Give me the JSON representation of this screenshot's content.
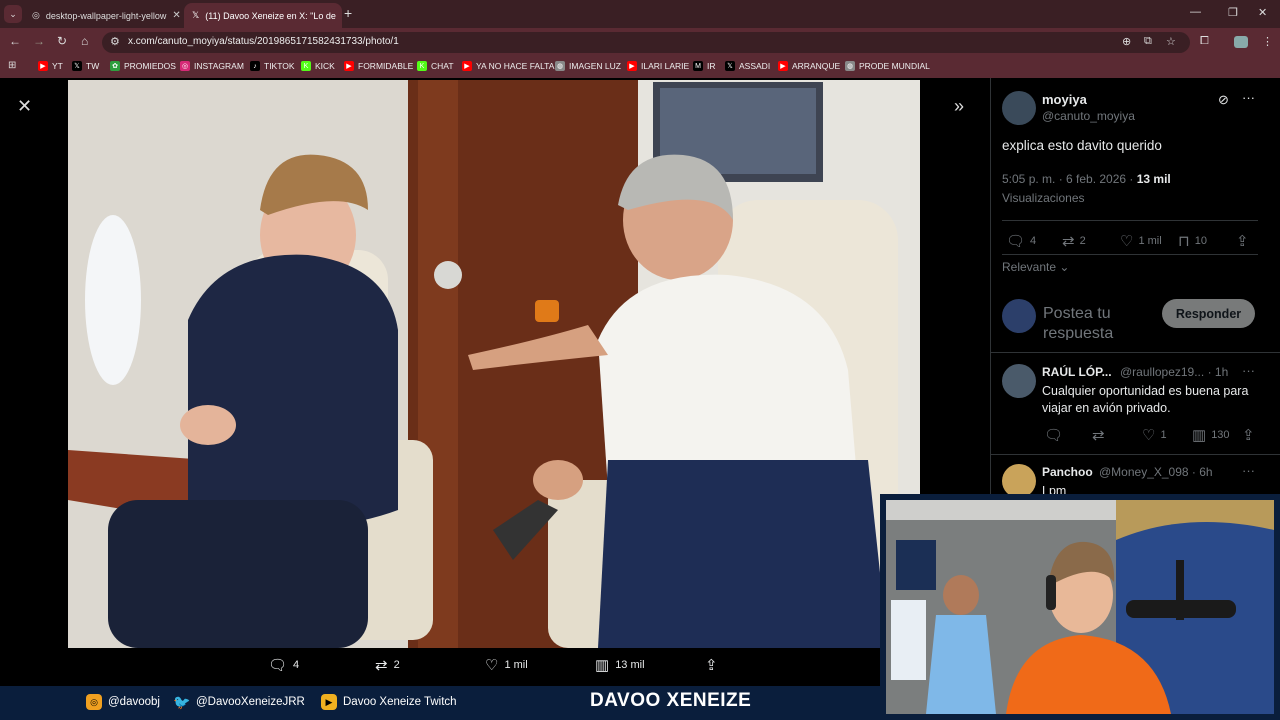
{
  "browser": {
    "tabs": [
      {
        "title": "desktop-wallpaper-light-yellow"
      },
      {
        "title": "(11) Davoo Xeneize en X: \"Lo de"
      }
    ],
    "url": "x.com/canuto_moyiya/status/2019865171582431733/photo/1",
    "bookmarks": [
      {
        "label": "YT",
        "icon": "youtube-icon",
        "color": "#ff0000"
      },
      {
        "label": "TW",
        "icon": "x-icon",
        "color": "#000000"
      },
      {
        "label": "PROMIEDOS",
        "icon": "promiedos-icon",
        "color": "#2e9e3e"
      },
      {
        "label": "INSTAGRAM",
        "icon": "instagram-icon",
        "color": "#d62976"
      },
      {
        "label": "TIKTOK",
        "icon": "tiktok-icon",
        "color": "#000000"
      },
      {
        "label": "KICK",
        "icon": "kick-icon",
        "color": "#53fc18"
      },
      {
        "label": "FORMIDABLE",
        "icon": "youtube-icon",
        "color": "#ff0000"
      },
      {
        "label": "CHAT",
        "icon": "kick-icon",
        "color": "#53fc18"
      },
      {
        "label": "YA NO HACE FALTA",
        "icon": "youtube-icon",
        "color": "#ff0000"
      },
      {
        "label": "IMAGEN LUZ",
        "icon": "globe-icon",
        "color": "#888888"
      },
      {
        "label": "ILARI LARIE",
        "icon": "youtube-icon",
        "color": "#ff0000"
      },
      {
        "label": "IR",
        "icon": "mk-icon",
        "color": "#000000"
      },
      {
        "label": "ASSADI",
        "icon": "x-icon",
        "color": "#000000"
      },
      {
        "label": "ARRANQUE",
        "icon": "youtube-icon",
        "color": "#ff0000"
      },
      {
        "label": "PRODE MUNDIAL",
        "icon": "globe-icon",
        "color": "#888888"
      }
    ]
  },
  "photo_actions": {
    "replies": "4",
    "reposts": "2",
    "likes": "1 mil",
    "views": "13 mil"
  },
  "tweet": {
    "author_name": "moyiya",
    "author_handle": "@canuto_moyiya",
    "text": "explica esto davito querido",
    "time": "5:05 p. m. · 6 feb. 2026 · ",
    "views": "13 mil",
    "views_label": "Visualizaciones",
    "replies": "4",
    "reposts": "2",
    "likes": "1 mil",
    "bookmarks": "10",
    "sort_label": "Relevante",
    "reply_placeholder": "Postea tu respuesta",
    "reply_button": "Responder"
  },
  "replies": [
    {
      "name": "RAÚL LÓP...",
      "handle": "@raullopez19...",
      "time": "· 1h",
      "text": "Cualquier oportunidad es buena para viajar en avión privado.",
      "likes": "1",
      "views": "130"
    },
    {
      "name": "Panchoo",
      "handle": "@Money_X_098",
      "time": "· 6h",
      "text": "Lpm"
    }
  ],
  "stream_bar": {
    "instagram": "@davoobj",
    "twitter": "@DavooXeneizeJRR",
    "twitch": "Davoo Xeneize Twitch",
    "title": "DAVOO XENEIZE"
  }
}
